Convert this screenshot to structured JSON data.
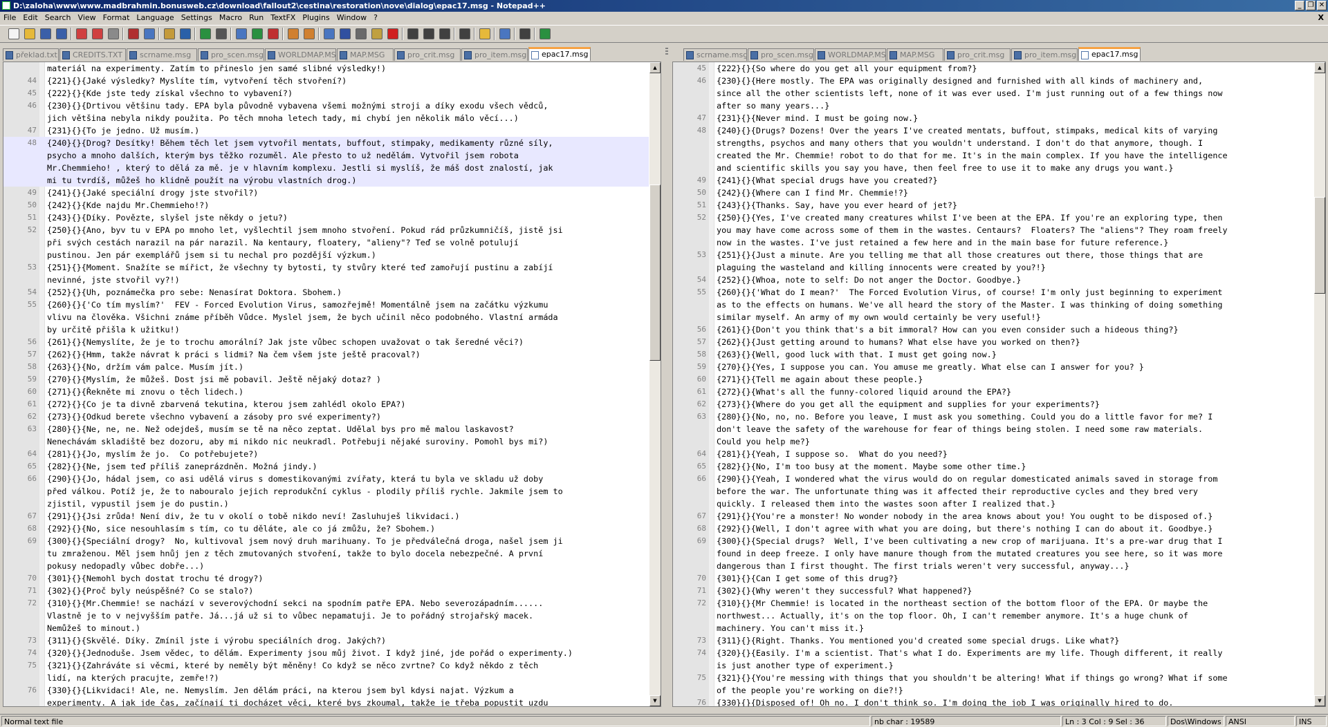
{
  "window": {
    "title": "D:\\zaloha\\www\\www.madbrahmin.bonusweb.cz\\download\\fallout2\\cestina\\restoration\\nove\\dialog\\epac17.msg - Notepad++",
    "minimize": "_",
    "restore": "❐",
    "close": "✕"
  },
  "menubar": {
    "items": [
      "File",
      "Edit",
      "Search",
      "View",
      "Format",
      "Language",
      "Settings",
      "Macro",
      "Run",
      "TextFX",
      "Plugins",
      "Window",
      "?"
    ],
    "close_glyph": "X"
  },
  "toolbar": {
    "buttons": [
      {
        "name": "new-file-icon",
        "color": "#f4f4f4"
      },
      {
        "name": "open-file-icon",
        "color": "#e6b93a"
      },
      {
        "name": "save-icon",
        "color": "#3a5fa8"
      },
      {
        "name": "save-all-icon",
        "color": "#3a5fa8"
      },
      {
        "name": "close-file-icon",
        "color": "#d04040"
      },
      {
        "name": "close-all-icon",
        "color": "#d04040"
      },
      {
        "name": "print-icon",
        "color": "#8a8a8a"
      },
      {
        "name": "cut-icon",
        "color": "#b03030"
      },
      {
        "name": "copy-icon",
        "color": "#4a76c0"
      },
      {
        "name": "paste-icon",
        "color": "#c49a3a"
      },
      {
        "name": "undo-icon",
        "color": "#2a60a8"
      },
      {
        "name": "redo-icon",
        "color": "#2a9040"
      },
      {
        "name": "find-icon",
        "color": "#555555"
      },
      {
        "name": "replace-icon",
        "color": "#4a76c0"
      },
      {
        "name": "zoom-in-icon",
        "color": "#2a9040"
      },
      {
        "name": "zoom-out-icon",
        "color": "#c03030"
      },
      {
        "name": "sync-v-icon",
        "color": "#d08030"
      },
      {
        "name": "sync-h-icon",
        "color": "#d08030"
      },
      {
        "name": "word-wrap-icon",
        "color": "#4a76c0"
      },
      {
        "name": "show-all-chars-icon",
        "color": "#3050a0"
      },
      {
        "name": "indent-guide-icon",
        "color": "#6a6a6a"
      },
      {
        "name": "user-lang-icon",
        "color": "#c0a040"
      },
      {
        "name": "record-macro-icon",
        "color": "#d02020"
      },
      {
        "name": "stop-macro-icon",
        "color": "#404040"
      },
      {
        "name": "play-macro-icon",
        "color": "#404040"
      },
      {
        "name": "play-multi-icon",
        "color": "#404040"
      },
      {
        "name": "save-macro-icon",
        "color": "#404040"
      },
      {
        "name": "explorer-icon",
        "color": "#e6b93a"
      },
      {
        "name": "panel-icon",
        "color": "#4a76c0"
      },
      {
        "name": "console-icon",
        "color": "#404040"
      },
      {
        "name": "spell-check-icon",
        "color": "#2a9040"
      }
    ]
  },
  "tabs_left": [
    {
      "label": "překlad.txt",
      "active": false
    },
    {
      "label": "CREDITS.TXT",
      "active": false
    },
    {
      "label": "scrname.msg",
      "active": false
    },
    {
      "label": "pro_scen.msg",
      "active": false
    },
    {
      "label": "WORLDMAP.MSG",
      "active": false
    },
    {
      "label": "MAP.MSG",
      "active": false
    },
    {
      "label": "pro_crit.msg",
      "active": false
    },
    {
      "label": "pro_item.msg",
      "active": false
    },
    {
      "label": "epac17.msg",
      "active": true
    }
  ],
  "tabs_right": [
    {
      "label": "scrname.msg",
      "active": false
    },
    {
      "label": "pro_scen.msg",
      "active": false
    },
    {
      "label": "WORLDMAP.MSG",
      "active": false
    },
    {
      "label": "MAP.MSG",
      "active": false
    },
    {
      "label": "pro_crit.msg",
      "active": false
    },
    {
      "label": "pro_item.msg",
      "active": false
    },
    {
      "label": "epac17.msg",
      "active": true
    }
  ],
  "left_editor": {
    "highlight_line": 48,
    "rows": [
      {
        "ln": "",
        "text": "materiál na experimenty. Zatím to přineslo jen samé slibné výsledky!)"
      },
      {
        "ln": "44",
        "text": "{221}{}{Jaké výsledky? Myslíte tím, vytvoření těch stvoření?)"
      },
      {
        "ln": "45",
        "text": "{222}{}{Kde jste tedy získal všechno to vybavení?)"
      },
      {
        "ln": "46",
        "text": "{230}{}{Drtivou většinu tady. EPA byla původně vybavena všemi možnými stroji a díky exodu všech vědců,"
      },
      {
        "ln": "",
        "text": "jich většina nebyla nikdy použita. Po těch mnoha letech tady, mi chybí jen několik málo věcí...)"
      },
      {
        "ln": "47",
        "text": "{231}{}{To je jedno. Už musím.)"
      },
      {
        "ln": "48",
        "text": "{240}{}{Drog? Desítky! Během těch let jsem vytvořil mentats, buffout, stimpaky, medikamenty různé síly,"
      },
      {
        "ln": "",
        "text": "psycho a mnoho dalších, kterým bys těžko rozuměl. Ale přesto to už nedělám. Vytvořil jsem robota"
      },
      {
        "ln": "",
        "text": "Mr.Chemmieho! , který to dělá za mě. je v hlavním komplexu. Jestli si myslíš, že máš dost znalostí, jak"
      },
      {
        "ln": "",
        "text": "mi tu tvrdíš, můžeš ho klidně použít na výrobu vlastních drog.)"
      },
      {
        "ln": "49",
        "text": "{241}{}{Jaké speciální drogy jste stvořil?)"
      },
      {
        "ln": "50",
        "text": "{242}{}{Kde najdu Mr.Chemmieho!?)"
      },
      {
        "ln": "51",
        "text": "{243}{}{Díky. Povězte, slyšel jste někdy o jetu?)"
      },
      {
        "ln": "52",
        "text": "{250}{}{Ano, byv tu v EPA po mnoho let, vyšlechtil jsem mnoho stvoření. Pokud rád průzkumničíš, jistě jsi"
      },
      {
        "ln": "",
        "text": "při svých cestách narazil na pár narazil. Na kentaury, floatery, \"alieny\"? Teď se volně potulují"
      },
      {
        "ln": "",
        "text": "pustinou. Jen pár exemplářů jsem si tu nechal pro pozdější výzkum.)"
      },
      {
        "ln": "53",
        "text": "{251}{}{Moment. Snažíte se mířict, že všechny ty bytosti, ty stvůry které teď zamořují pustinu a zabíjí"
      },
      {
        "ln": "",
        "text": "nevinné, jste stvořil vy?!)"
      },
      {
        "ln": "54",
        "text": "{252}{}{Uh, poznámečka pro sebe: Nenasírat Doktora. Sbohem.)"
      },
      {
        "ln": "55",
        "text": "{260}{}{'Co tím myslím?'  FEV - Forced Evolution Virus, samozřejmě! Momentálně jsem na začátku výzkumu"
      },
      {
        "ln": "",
        "text": "vlivu na člověka. Všichni známe příběh Vůdce. Myslel jsem, že bych učinil něco podobného. Vlastní armáda"
      },
      {
        "ln": "",
        "text": "by určitě přišla k užitku!)"
      },
      {
        "ln": "56",
        "text": "{261}{}{Nemyslíte, že je to trochu amorální? Jak jste vůbec schopen uvažovat o tak šeredné věci?)"
      },
      {
        "ln": "57",
        "text": "{262}{}{Hmm, takže návrat k práci s lidmi? Na čem všem jste ještě pracoval?)"
      },
      {
        "ln": "58",
        "text": "{263}{}{No, držím vám palce. Musím jít.)"
      },
      {
        "ln": "59",
        "text": "{270}{}{Myslím, že můžeš. Dost jsi mě pobavil. Ještě nějaký dotaz? )"
      },
      {
        "ln": "60",
        "text": "{271}{}{Řekněte mi znovu o těch lidech.)"
      },
      {
        "ln": "61",
        "text": "{272}{}{Co je ta divně zbarvená tekutina, kterou jsem zahlédl okolo EPA?)"
      },
      {
        "ln": "62",
        "text": "{273}{}{Odkud berete všechno vybavení a zásoby pro své experimenty?)"
      },
      {
        "ln": "63",
        "text": "{280}{}{Ne, ne, ne. Než odejdeš, musím se tě na něco zeptat. Udělal bys pro mě malou laskavost?"
      },
      {
        "ln": "",
        "text": "Nenechávám skladiště bez dozoru, aby mi nikdo nic neukradl. Potřebuji nějaké suroviny. Pomohl bys mi?)"
      },
      {
        "ln": "64",
        "text": "{281}{}{Jo, myslím že jo.  Co potřebujete?)"
      },
      {
        "ln": "65",
        "text": "{282}{}{Ne, jsem teď příliš zaneprázdněn. Možná jindy.)"
      },
      {
        "ln": "66",
        "text": "{290}{}{Jo, hádal jsem, co asi udělá virus s domestikovanými zvířaty, která tu byla ve skladu už doby"
      },
      {
        "ln": "",
        "text": "před válkou. Potíž je, že to nabouralo jejich reprodukční cyklus - plodily příliš rychle. Jakmile jsem to"
      },
      {
        "ln": "",
        "text": "zjistil, vypustil jsem je do pustin.)"
      },
      {
        "ln": "67",
        "text": "{291}{}{Jsi zrůda! Není div, že tu v okolí o tobě nikdo neví! Zasluhuješ likvidaci.)"
      },
      {
        "ln": "68",
        "text": "{292}{}{No, sice nesouhlasím s tím, co tu děláte, ale co já zmůžu, že? Sbohem.)"
      },
      {
        "ln": "69",
        "text": "{300}{}{Speciální drogy?  No, kultivoval jsem nový druh marihuany. To je předválečná droga, našel jsem ji"
      },
      {
        "ln": "",
        "text": "tu zmraženou. Měl jsem hnůj jen z těch zmutovaných stvoření, takže to bylo docela nebezpečné. A první"
      },
      {
        "ln": "",
        "text": "pokusy nedopadly vůbec dobře...)"
      },
      {
        "ln": "70",
        "text": "{301}{}{Nemohl bych dostat trochu té drogy?)"
      },
      {
        "ln": "71",
        "text": "{302}{}{Proč byly neúspěšné? Co se stalo?)"
      },
      {
        "ln": "72",
        "text": "{310}{}{Mr.Chemmie! se nachází v severovýchodní sekci na spodním patře EPA. Nebo severozápadním......"
      },
      {
        "ln": "",
        "text": "Vlastně je to v nejvyšším patře. Já...já už si to vůbec nepamatuji. Je to pořádný strojařský macek."
      },
      {
        "ln": "",
        "text": "Nemůžeš to minout.)"
      },
      {
        "ln": "73",
        "text": "{311}{}{Skvělé. Díky. Zmínil jste i výrobu speciálních drog. Jakých?)"
      },
      {
        "ln": "74",
        "text": "{320}{}{Jednoduše. Jsem vědec, to dělám. Experimenty jsou můj život. I když jiné, jde pořád o experimenty.)"
      },
      {
        "ln": "75",
        "text": "{321}{}{Zahráváte si věcmi, které by neměly být měněny! Co když se něco zvrtne? Co když někdo z těch"
      },
      {
        "ln": "",
        "text": "lidí, na kterých pracujte, zemře!?)"
      },
      {
        "ln": "76",
        "text": "{330}{}{Likvidaci! Ale, ne. Nemyslím. Jen dělám práci, na kterou jsem byl kdysi najat. Výzkum a"
      },
      {
        "ln": "",
        "text": "experimenty. A jak jde čas, začínají ti docházet věci, které bys zkoumal, takže je třeba popustit uzdu"
      }
    ]
  },
  "right_editor": {
    "rows": [
      {
        "ln": "45",
        "text": "{222}{}{So where do you get all your equipment from?}"
      },
      {
        "ln": "46",
        "text": "{230}{}{Here mostly. The EPA was originally designed and furnished with all kinds of machinery and,"
      },
      {
        "ln": "",
        "text": "since all the other scientists left, none of it was ever used. I'm just running out of a few things now"
      },
      {
        "ln": "",
        "text": "after so many years...}"
      },
      {
        "ln": "47",
        "text": "{231}{}{Never mind. I must be going now.}"
      },
      {
        "ln": "48",
        "text": "{240}{}{Drugs? Dozens! Over the years I've created mentats, buffout, stimpaks, medical kits of varying"
      },
      {
        "ln": "",
        "text": "strengths, psychos and many others that you wouldn't understand. I don't do that anymore, though. I"
      },
      {
        "ln": "",
        "text": "created the Mr. Chemmie! robot to do that for me. It's in the main complex. If you have the intelligence"
      },
      {
        "ln": "",
        "text": "and scientific skills you say you have, then feel free to use it to make any drugs you want.}"
      },
      {
        "ln": "49",
        "text": "{241}{}{What special drugs have you created?}"
      },
      {
        "ln": "50",
        "text": "{242}{}{Where can I find Mr. Chemmie!?}"
      },
      {
        "ln": "51",
        "text": "{243}{}{Thanks. Say, have you ever heard of jet?}"
      },
      {
        "ln": "52",
        "text": "{250}{}{Yes, I've created many creatures whilst I've been at the EPA. If you're an exploring type, then"
      },
      {
        "ln": "",
        "text": "you may have come across some of them in the wastes. Centaurs?  Floaters? The \"aliens\"? They roam freely"
      },
      {
        "ln": "",
        "text": "now in the wastes. I've just retained a few here and in the main base for future reference.}"
      },
      {
        "ln": "53",
        "text": "{251}{}{Just a minute. Are you telling me that all those creatures out there, those things that are"
      },
      {
        "ln": "",
        "text": "plaguing the wasteland and killing innocents were created by you?!}"
      },
      {
        "ln": "54",
        "text": "{252}{}{Whoa, note to self: Do not anger the Doctor. Goodbye.}"
      },
      {
        "ln": "55",
        "text": "{260}{}{'What do I mean?'  The Forced Evolution Virus, of course! I'm only just beginning to experiment"
      },
      {
        "ln": "",
        "text": "as to the effects on humans. We've all heard the story of the Master. I was thinking of doing something"
      },
      {
        "ln": "",
        "text": "similar myself. An army of my own would certainly be very useful!}"
      },
      {
        "ln": "56",
        "text": "{261}{}{Don't you think that's a bit immoral? How can you even consider such a hideous thing?}"
      },
      {
        "ln": "57",
        "text": "{262}{}{Just getting around to humans? What else have you worked on then?}"
      },
      {
        "ln": "58",
        "text": "{263}{}{Well, good luck with that. I must get going now.}"
      },
      {
        "ln": "59",
        "text": "{270}{}{Yes, I suppose you can. You amuse me greatly. What else can I answer for you? }"
      },
      {
        "ln": "60",
        "text": "{271}{}{Tell me again about these people.}"
      },
      {
        "ln": "61",
        "text": "{272}{}{What's all the funny-colored liquid around the EPA?}"
      },
      {
        "ln": "62",
        "text": "{273}{}{Where do you get all the equipment and supplies for your experiments?}"
      },
      {
        "ln": "63",
        "text": "{280}{}{No, no, no. Before you leave, I must ask you something. Could you do a little favor for me? I"
      },
      {
        "ln": "",
        "text": "don't leave the safety of the warehouse for fear of things being stolen. I need some raw materials."
      },
      {
        "ln": "",
        "text": "Could you help me?}"
      },
      {
        "ln": "64",
        "text": "{281}{}{Yeah, I suppose so.  What do you need?}"
      },
      {
        "ln": "65",
        "text": "{282}{}{No, I'm too busy at the moment. Maybe some other time.}"
      },
      {
        "ln": "66",
        "text": "{290}{}{Yeah, I wondered what the virus would do on regular domesticated animals saved in storage from"
      },
      {
        "ln": "",
        "text": "before the war. The unfortunate thing was it affected their reproductive cycles and they bred very"
      },
      {
        "ln": "",
        "text": "quickly. I released them into the wastes soon after I realized that.}"
      },
      {
        "ln": "67",
        "text": "{291}{}{You're a monster! No wonder nobody in the area knows about you! You ought to be disposed of.}"
      },
      {
        "ln": "68",
        "text": "{292}{}{Well, I don't agree with what you are doing, but there's nothing I can do about it. Goodbye.}"
      },
      {
        "ln": "69",
        "text": "{300}{}{Special drugs?  Well, I've been cultivating a new crop of marijuana. It's a pre-war drug that I"
      },
      {
        "ln": "",
        "text": "found in deep freeze. I only have manure though from the mutated creatures you see here, so it was more"
      },
      {
        "ln": "",
        "text": "dangerous than I first thought. The first trials weren't very successful, anyway...}"
      },
      {
        "ln": "70",
        "text": "{301}{}{Can I get some of this drug?}"
      },
      {
        "ln": "71",
        "text": "{302}{}{Why weren't they successful? What happened?}"
      },
      {
        "ln": "72",
        "text": "{310}{}{Mr Chemmie! is located in the northeast section of the bottom floor of the EPA. Or maybe the"
      },
      {
        "ln": "",
        "text": "northwest... Actually, it's on the top floor. Oh, I can't remember anymore. It's a huge chunk of"
      },
      {
        "ln": "",
        "text": "machinery. You can't miss it.}"
      },
      {
        "ln": "73",
        "text": "{311}{}{Right. Thanks. You mentioned you'd created some special drugs. Like what?}"
      },
      {
        "ln": "74",
        "text": "{320}{}{Easily. I'm a scientist. That's what I do. Experiments are my life. Though different, it really"
      },
      {
        "ln": "",
        "text": "is just another type of experiment.}"
      },
      {
        "ln": "75",
        "text": "{321}{}{You're messing with things that you shouldn't be altering! What if things go wrong? What if some"
      },
      {
        "ln": "",
        "text": "of the people you're working on die?!}"
      },
      {
        "ln": "76",
        "text": "{330}{}{Disposed of! Oh no. I don't think so. I'm doing the job I was originally hired to do."
      }
    ]
  },
  "statusbar": {
    "file_type": "Normal text file",
    "nb_char": "nb char : 19589",
    "position": "Ln : 3    Col : 9    Sel : 36",
    "eol": "Dos\\Windows",
    "encoding": "ANSI",
    "mode": "INS"
  },
  "colors": {
    "active_tab_accent": "#f6a243",
    "highlight_line": "#e8e8ff",
    "title_gradient_start": "#0a246a"
  }
}
